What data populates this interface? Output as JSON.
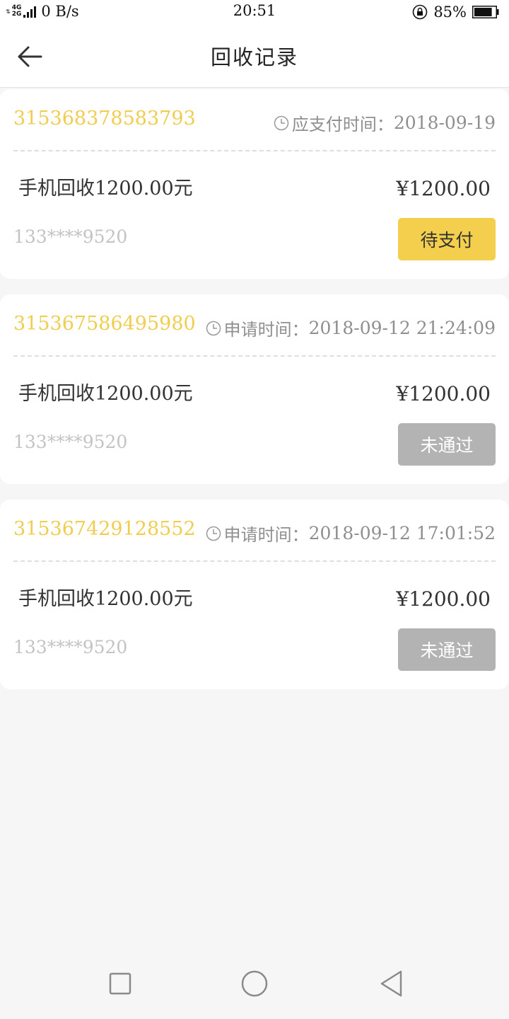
{
  "status_bar": {
    "net_tiny": "⇅",
    "net_type_top": "4G",
    "net_type_bottom": "2G",
    "speed": "0 B/s",
    "time": "20:51",
    "battery": "85%",
    "battery_level": 0.85,
    "icons": [
      "signal-icon",
      "lock-rotation-icon",
      "battery-icon"
    ]
  },
  "header": {
    "title": "回收记录",
    "back_icon": "arrow-left-icon"
  },
  "records": [
    {
      "order_id": "315368378583793",
      "time_label": "应支付时间：",
      "time_value": "2018-09-19",
      "desc_prefix": "手机回收",
      "desc_amount": "1200.00",
      "desc_suffix": "元",
      "price": "¥1200.00",
      "phone": "133****9520",
      "status": "待支付",
      "status_type": "pending"
    },
    {
      "order_id": "315367586495980",
      "time_label": "申请时间：",
      "time_value": "2018-09-12 21:24:09",
      "desc_prefix": "手机回收",
      "desc_amount": "1200.00",
      "desc_suffix": "元",
      "price": "¥1200.00",
      "phone": "133****9520",
      "status": "未通过",
      "status_type": "rejected"
    },
    {
      "order_id": "315367429128552",
      "time_label": "申请时间：",
      "time_value": "2018-09-12 17:01:52",
      "desc_prefix": "手机回收",
      "desc_amount": "1200.00",
      "desc_suffix": "元",
      "price": "¥1200.00",
      "phone": "133****9520",
      "status": "未通过",
      "status_type": "rejected"
    }
  ],
  "colors": {
    "accent_yellow": "#f0cd4f",
    "button_pending": "#f3cf4d",
    "button_rejected": "#b3b3b3",
    "background": "#f6f6f6"
  },
  "nav_bar": {
    "icons": [
      "recent-apps-icon",
      "home-icon",
      "back-triangle-icon"
    ]
  }
}
